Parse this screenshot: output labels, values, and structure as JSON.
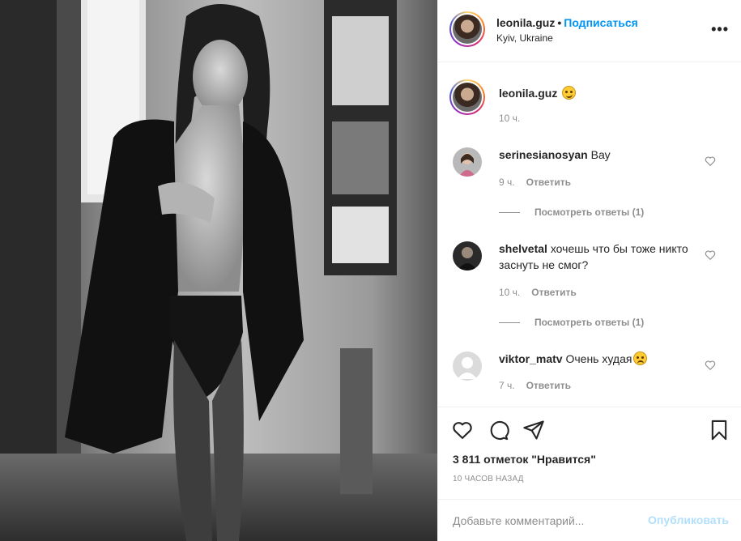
{
  "header": {
    "username": "leonila.guz",
    "separator": "•",
    "follow_label": "Подписаться",
    "location": "Kyiv, Ukraine",
    "more_icon": "more-horizontal-icon"
  },
  "caption": {
    "username": "leonila.guz",
    "emoji": "smirking-face",
    "time": "10 ч."
  },
  "comments": [
    {
      "username": "serinesianosyan",
      "text": "Вау",
      "time": "9 ч.",
      "reply_label": "Ответить",
      "view_replies": "Посмотреть ответы (1)"
    },
    {
      "username": "shelvetal",
      "text": "хочешь что бы тоже никто заснуть не смог?",
      "time": "10 ч.",
      "reply_label": "Ответить",
      "view_replies": "Посмотреть ответы (1)"
    },
    {
      "username": "viktor_matv",
      "text": "Очень худая",
      "emoji": "frowning-face",
      "time": "7 ч.",
      "reply_label": "Ответить"
    }
  ],
  "actions": {
    "icons": [
      "heart-icon",
      "comment-icon",
      "share-icon",
      "bookmark-icon"
    ],
    "likes": "3 811 отметок \"Нравится\"",
    "posted_ago": "10 ЧАСОВ НАЗАД"
  },
  "add_comment": {
    "placeholder": "Добавьте комментарий...",
    "publish_label": "Опубликовать"
  },
  "colors": {
    "link_blue": "#0095f6",
    "publish_disabled": "#b2dffc",
    "secondary_text": "#8e8e8e",
    "primary_text": "#262626",
    "border": "#efefef"
  }
}
